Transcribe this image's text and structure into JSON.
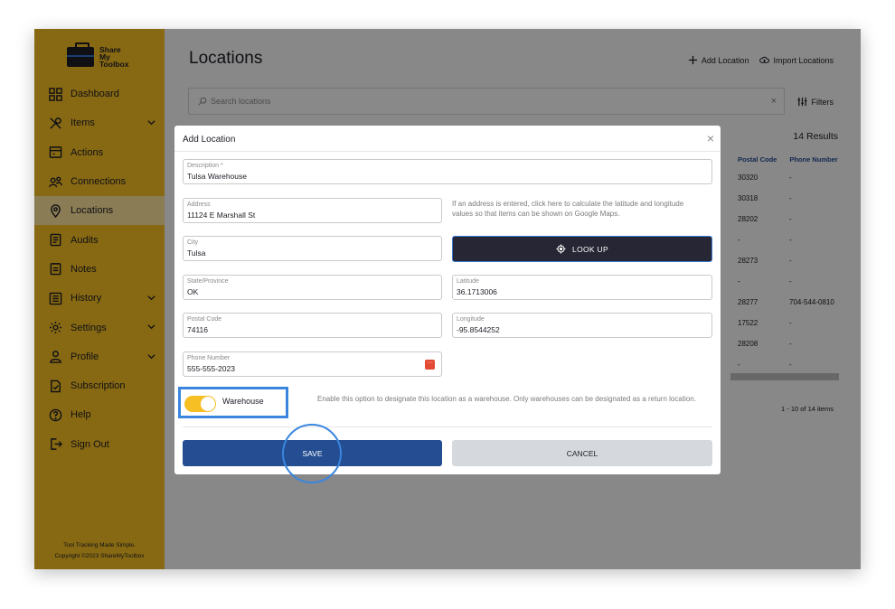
{
  "brand": {
    "line1": "Share",
    "line2": "My",
    "line3": "Toolbox"
  },
  "sidebar": {
    "items": [
      {
        "label": "Dashboard",
        "icon": "dashboard-grid-icon"
      },
      {
        "label": "Items",
        "icon": "tools-icon"
      },
      {
        "label": "Actions",
        "icon": "actions-icon"
      },
      {
        "label": "Connections",
        "icon": "connections-icon"
      },
      {
        "label": "Locations",
        "icon": "location-pin-icon"
      },
      {
        "label": "Audits",
        "icon": "audits-icon"
      },
      {
        "label": "Notes",
        "icon": "notes-icon"
      },
      {
        "label": "History",
        "icon": "history-icon"
      },
      {
        "label": "Settings",
        "icon": "gear-icon"
      },
      {
        "label": "Profile",
        "icon": "profile-icon"
      },
      {
        "label": "Subscription",
        "icon": "subscription-icon"
      },
      {
        "label": "Help",
        "icon": "help-icon"
      },
      {
        "label": "Sign Out",
        "icon": "sign-out-icon"
      }
    ],
    "active": "Locations",
    "footer_tagline": "Tool Tracking Made Simple.",
    "footer_copyright": "Copyright ©2023 ShareMyToolbox"
  },
  "page": {
    "title": "Locations",
    "add_location": "Add Location",
    "import_locations": "Import Locations",
    "search_placeholder": "Search locations",
    "filters": "Filters",
    "results": "14 Results",
    "columns": [
      "Postal Code",
      "Phone Number"
    ],
    "rows": [
      [
        "30320",
        "-"
      ],
      [
        "30318",
        "-"
      ],
      [
        "28202",
        "-"
      ],
      [
        "-",
        "-"
      ],
      [
        "28273",
        "-"
      ],
      [
        "-",
        "-"
      ],
      [
        "28277",
        "704-544-0810"
      ],
      [
        "17522",
        "-"
      ],
      [
        "28208",
        "-"
      ],
      [
        "-",
        "-"
      ]
    ],
    "pager": "1 - 10 of 14 items"
  },
  "modal": {
    "title": "Add Location",
    "description": {
      "label": "Description *",
      "value": "Tulsa Warehouse"
    },
    "address": {
      "label": "Address",
      "value": "11124 E Marshall St"
    },
    "address_hint": "If an address is entered, click here to calculate the latitude and longitude values so that items can be shown on Google Maps.",
    "city": {
      "label": "City",
      "value": "Tulsa"
    },
    "lookup_label": "LOOK UP",
    "state": {
      "label": "State/Province",
      "value": "OK"
    },
    "latitude": {
      "label": "Latitude",
      "value": "36.1713006"
    },
    "postal": {
      "label": "Postal Code",
      "value": "74116"
    },
    "longitude": {
      "label": "Longitude",
      "value": "-95.8544252"
    },
    "phone": {
      "label": "Phone Number",
      "value": "555-555-2023"
    },
    "warehouse_label": "Warehouse",
    "warehouse_on": true,
    "warehouse_desc": "Enable this option to designate this location as a warehouse. Only warehouses can be designated as a return location.",
    "save_label": "SAVE",
    "cancel_label": "CANCEL"
  },
  "colors": {
    "accent": "#f6bf24",
    "primary": "#244d92",
    "dark": "#272634",
    "highlight": "#3a86de"
  }
}
